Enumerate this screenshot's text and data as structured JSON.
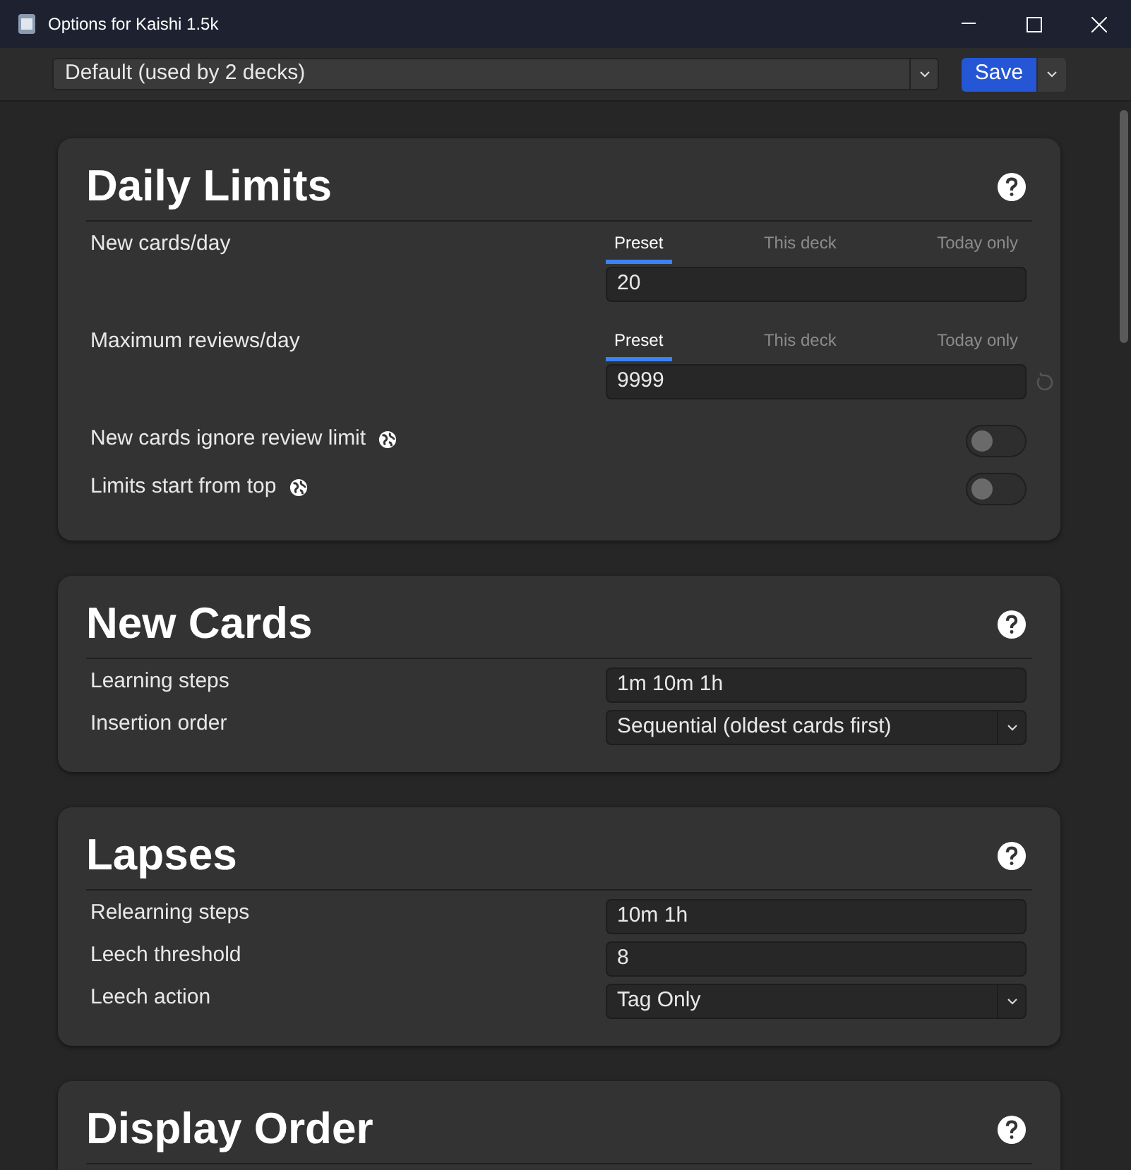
{
  "window": {
    "title": "Options for Kaishi 1.5k"
  },
  "toolbar": {
    "preset": "Default (used by 2 decks)",
    "save": "Save"
  },
  "sections": [
    {
      "title": "Daily Limits",
      "rows": [
        {
          "kind": "tabbed",
          "label": "New cards/day",
          "tabs": [
            {
              "label": "Preset",
              "selected": true
            },
            {
              "label": "This deck",
              "selected": false
            },
            {
              "label": "Today only",
              "selected": false
            }
          ],
          "value": "20",
          "reset": false
        },
        {
          "kind": "tabbed",
          "label": "Maximum reviews/day",
          "tabs": [
            {
              "label": "Preset",
              "selected": true
            },
            {
              "label": "This deck",
              "selected": false
            },
            {
              "label": "Today only",
              "selected": false
            }
          ],
          "value": "9999",
          "reset": true
        },
        {
          "kind": "toggle",
          "label": "New cards ignore review limit",
          "global": true,
          "on": false
        },
        {
          "kind": "toggle",
          "label": "Limits start from top",
          "global": true,
          "on": false
        }
      ]
    },
    {
      "title": "New Cards",
      "rows": [
        {
          "kind": "text",
          "label": "Learning steps",
          "value": "1m 10m 1h"
        },
        {
          "kind": "select",
          "label": "Insertion order",
          "value": "Sequential (oldest cards first)"
        }
      ]
    },
    {
      "title": "Lapses",
      "rows": [
        {
          "kind": "text",
          "label": "Relearning steps",
          "value": "10m 1h"
        },
        {
          "kind": "text",
          "label": "Leech threshold",
          "value": "8"
        },
        {
          "kind": "select",
          "label": "Leech action",
          "value": "Tag Only"
        }
      ]
    },
    {
      "title": "Display Order"
    }
  ]
}
